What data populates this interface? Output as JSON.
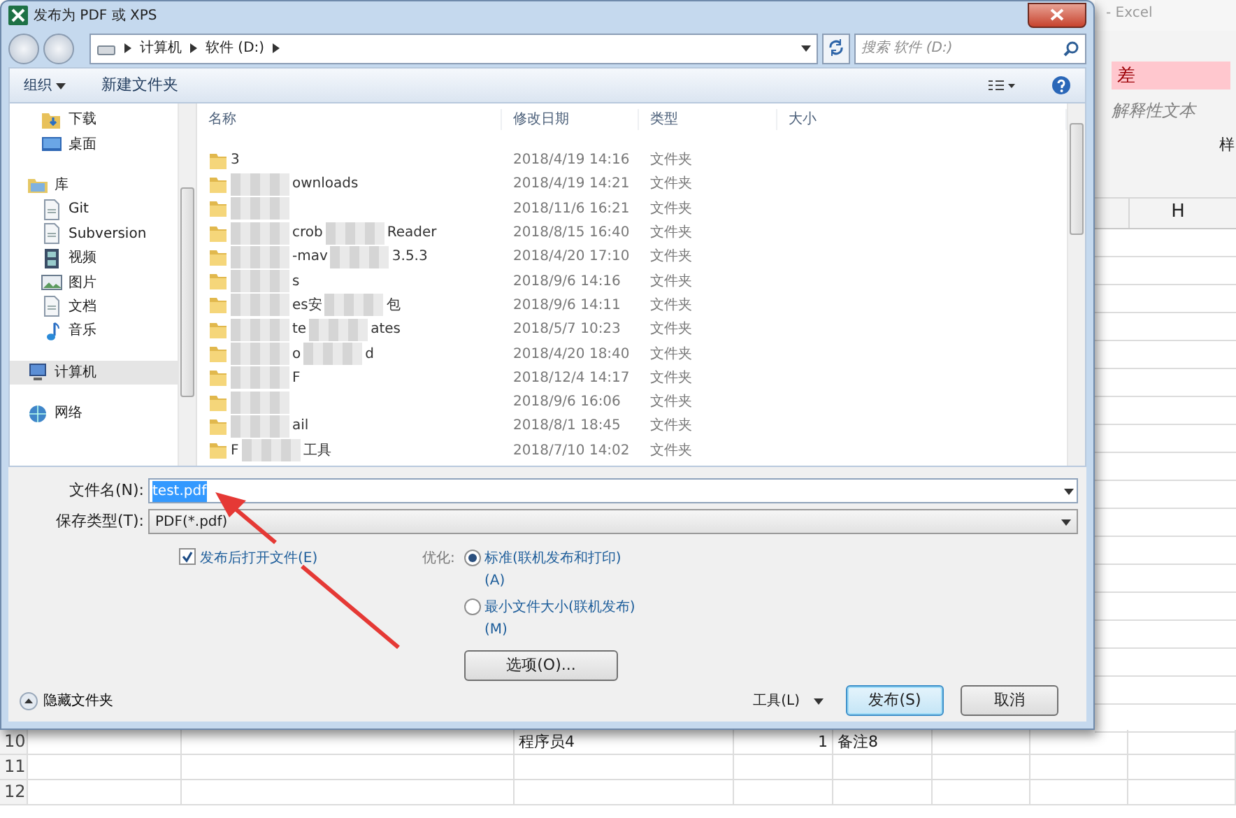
{
  "window": {
    "title": "发布为 PDF 或 XPS"
  },
  "address": {
    "crumbs": [
      "计算机",
      "软件 (D:)"
    ]
  },
  "search": {
    "placeholder": "搜索 软件 (D:)"
  },
  "toolbar": {
    "organize": "组织",
    "new_folder": "新建文件夹"
  },
  "sidebar": {
    "groups": [
      {
        "children": [
          {
            "label": "下载",
            "kind": "download",
            "selected": false
          },
          {
            "label": "桌面",
            "kind": "desktop",
            "selected": false
          }
        ]
      },
      {
        "label": "库",
        "kind": "library",
        "selected": false,
        "children": [
          {
            "label": "Git",
            "kind": "doc",
            "selected": false
          },
          {
            "label": "Subversion",
            "kind": "doc",
            "selected": false
          },
          {
            "label": "视频",
            "kind": "video",
            "selected": false
          },
          {
            "label": "图片",
            "kind": "picture",
            "selected": false
          },
          {
            "label": "文档",
            "kind": "doc",
            "selected": false
          },
          {
            "label": "音乐",
            "kind": "music",
            "selected": false
          }
        ]
      },
      {
        "label": "计算机",
        "kind": "computer",
        "selected": true
      },
      {
        "label": "网络",
        "kind": "network",
        "selected": false
      }
    ]
  },
  "table": {
    "columns": [
      "名称",
      "修改日期",
      "类型",
      "大小"
    ],
    "rows": [
      {
        "name_lead": true,
        "name_parts": [
          "3"
        ],
        "modified": "2018/4/19 14:16",
        "type": "文件夹"
      },
      {
        "name_lead": false,
        "name_parts": [
          "ownloads"
        ],
        "modified": "2018/4/19 14:21",
        "type": "文件夹"
      },
      {
        "name_parts": [],
        "modified": "2018/11/6 16:21",
        "type": "文件夹"
      },
      {
        "name_lead": false,
        "name_parts": [
          "crob",
          "Reader"
        ],
        "modified": "2018/8/15 16:40",
        "type": "文件夹"
      },
      {
        "name_lead": false,
        "name_parts": [
          "-mav",
          "3.5.3"
        ],
        "modified": "2018/4/20 17:10",
        "type": "文件夹"
      },
      {
        "name_lead": false,
        "name_parts": [
          "s"
        ],
        "modified": "2018/9/6 14:16",
        "type": "文件夹"
      },
      {
        "name_lead": false,
        "name_parts": [
          "es安",
          "包"
        ],
        "modified": "2018/9/6 14:11",
        "type": "文件夹"
      },
      {
        "name_lead": false,
        "name_parts": [
          "te",
          "ates"
        ],
        "modified": "2018/5/7 10:23",
        "type": "文件夹"
      },
      {
        "name_lead": false,
        "name_parts": [
          "o",
          "d"
        ],
        "modified": "2018/4/20 18:40",
        "type": "文件夹"
      },
      {
        "name_lead": false,
        "name_parts": [
          "F"
        ],
        "modified": "2018/12/4 14:17",
        "type": "文件夹"
      },
      {
        "name_parts": [],
        "modified": "2018/9/6 16:06",
        "type": "文件夹"
      },
      {
        "name_lead": false,
        "name_parts": [
          "ail"
        ],
        "modified": "2018/8/1 18:45",
        "type": "文件夹"
      },
      {
        "name_lead": true,
        "name_parts": [
          "F",
          "工具"
        ],
        "modified": "2018/7/10 14:02",
        "type": "文件夹"
      }
    ]
  },
  "form": {
    "filename_label": "文件名(N):",
    "filename": "test.pdf",
    "type_label": "保存类型(T):",
    "type": "PDF(*.pdf)",
    "open_after": {
      "label": "发布后打开文件(E)",
      "checked": true
    },
    "optimize_label": "优化:",
    "optimize": [
      {
        "label": "标准(联机发布和打印)(A)",
        "selected": true
      },
      {
        "label": "最小文件大小(联机发布)(M)",
        "selected": false
      }
    ],
    "options_button": "选项(O)..."
  },
  "footer": {
    "hide_folders": "隐藏文件夹",
    "tools": "工具(L)",
    "buttons": [
      {
        "label": "发布(S)",
        "kind": "default"
      },
      {
        "label": "取消",
        "kind": "normal"
      }
    ]
  },
  "excel": {
    "title": "- Excel",
    "styles": [
      {
        "text": "差",
        "kind": "bad"
      },
      {
        "text": "解释性文本",
        "kind": "explanatory"
      }
    ],
    "ribbon_cut": "样",
    "column": "H",
    "rows": [
      {
        "number": "10",
        "cells": {
          "column_3": "程序员4",
          "column_4": "1",
          "column_5": "备注8"
        }
      },
      {
        "number": "11"
      },
      {
        "number": "12"
      }
    ]
  }
}
